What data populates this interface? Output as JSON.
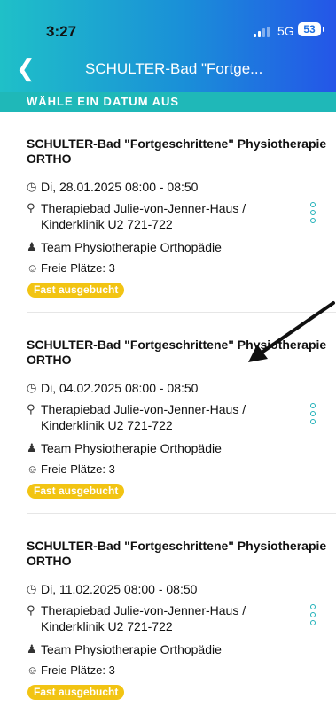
{
  "status_bar": {
    "time": "3:27",
    "network": "5G",
    "battery": "53"
  },
  "nav": {
    "back_icon": "chevron-left-icon",
    "title": "SCHULTER-Bad \"Fortge..."
  },
  "section": {
    "label": "WÄHLE EIN DATUM AUS"
  },
  "appointments": [
    {
      "title": "SCHULTER-Bad \"Fortgeschrittene\" Physiotherapie ORTHO",
      "datetime": "Di, 28.01.2025 08:00 - 08:50",
      "location": "Therapiebad Julie-von-Jenner-Haus / Kinderklinik U2 721-722",
      "team": "Team Physiotherapie Orthopädie",
      "seats": "Freie Plätze: 3",
      "badge": "Fast ausgebucht"
    },
    {
      "title": "SCHULTER-Bad \"Fortgeschrittene\" Physiotherapie ORTHO",
      "datetime": "Di, 04.02.2025 08:00 - 08:50",
      "location": "Therapiebad Julie-von-Jenner-Haus / Kinderklinik U2 721-722",
      "team": "Team Physiotherapie Orthopädie",
      "seats": "Freie Plätze: 3",
      "badge": "Fast ausgebucht"
    },
    {
      "title": "SCHULTER-Bad \"Fortgeschrittene\" Physiotherapie ORTHO",
      "datetime": "Di, 11.02.2025 08:00 - 08:50",
      "location": "Therapiebad Julie-von-Jenner-Haus / Kinderklinik U2 721-722",
      "team": "Team Physiotherapie Orthopädie",
      "seats": "Freie Plätze: 3",
      "badge": "Fast ausgebucht"
    }
  ],
  "colors": {
    "accent": "#1fb8b8",
    "badge": "#f2c413",
    "header_start": "#1fc0c8",
    "header_end": "#2456e8"
  }
}
